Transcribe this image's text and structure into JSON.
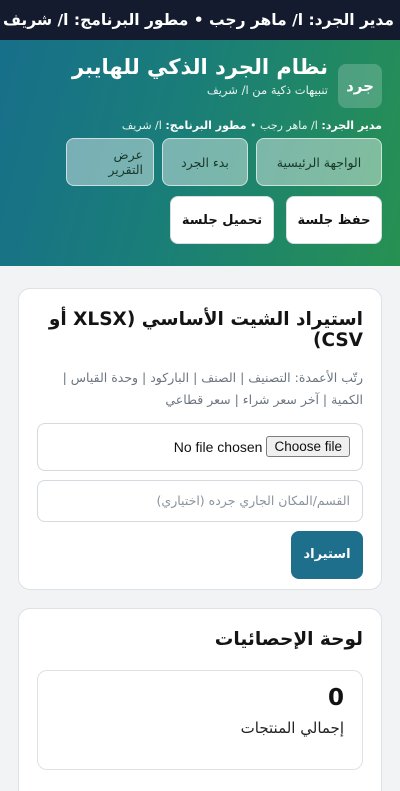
{
  "topbar": {
    "text": "مدير الجرد: ا/ ماهر رجب • مطور البرنامج: ا/ شريف"
  },
  "header": {
    "logo_text": "جرد",
    "title": "نظام الجرد الذكي للهايبر",
    "subtitle": "تنبيهات ذكية من ا/ شريف",
    "credits": {
      "manager_label": "مدير الجرد:",
      "manager_value": "ا/ ماهر رجب •",
      "developer_label": "مطور البرنامج:",
      "developer_value": "ا/ شريف"
    },
    "nav": {
      "home": "الواجهة الرئيسية",
      "start": "بدء الجرد",
      "report": "عرض التقرير"
    },
    "session": {
      "save": "حفظ جلسة",
      "load": "تحميل جلسة"
    }
  },
  "import_card": {
    "title": "استيراد الشيت الأساسي (XLSX أو CSV)",
    "hint": "رتّب الأعمدة: التصنيف | الصنف | الباركود | وحدة القياس | الكمية | آخر سعر شراء | سعر قطاعي",
    "file_button": "Choose file",
    "file_status": "No file chosen",
    "section_placeholder": "القسم/المكان الجاري جرده (اختياري)",
    "import_button": "استيراد"
  },
  "stats_card": {
    "title": "لوحة الإحصائيات",
    "total_products_value": "0",
    "total_products_label": "إجمالي المنتجات"
  }
}
